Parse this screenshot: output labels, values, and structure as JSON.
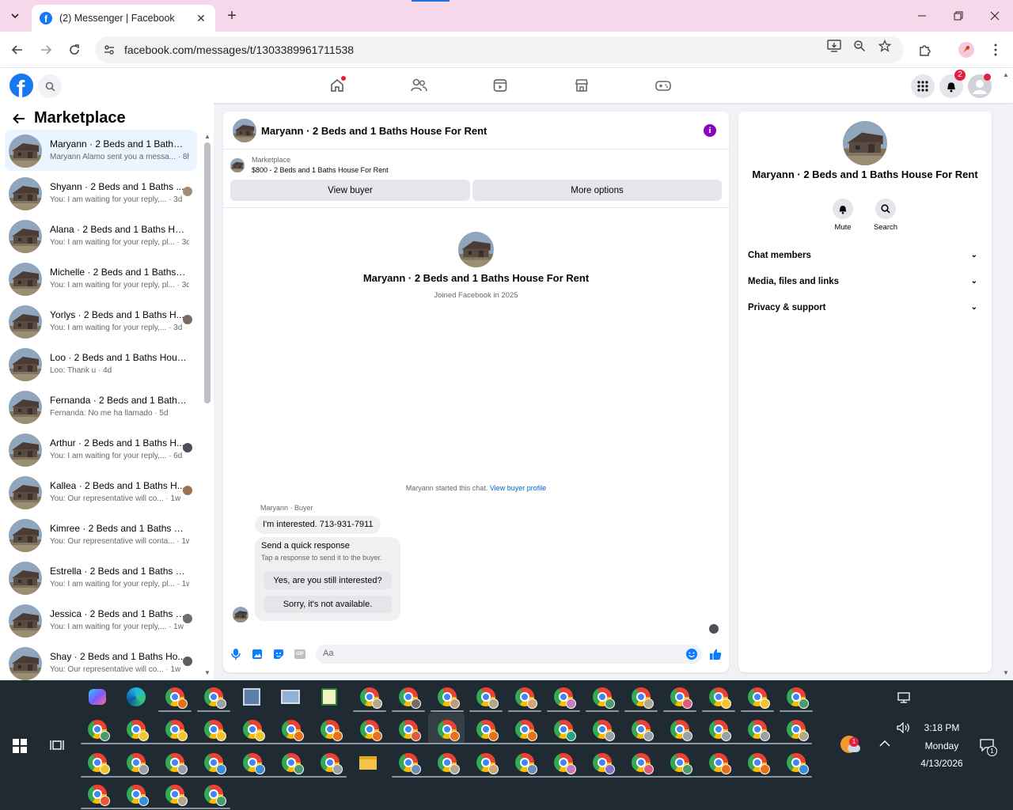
{
  "browser": {
    "tab_title": "(2) Messenger | Facebook",
    "url": "facebook.com/messages/t/1303389961711538"
  },
  "facebook": {
    "notification_count": "2"
  },
  "left_panel": {
    "title": "Marketplace",
    "conversations": [
      {
        "name": "Maryann · 2 Beds and 1 Baths H...",
        "snippet": "Maryann Alamo sent you a messa... · 8h",
        "active": true
      },
      {
        "name": "Shyann · 2 Beds and 1 Baths ...",
        "snippet": "You: I am waiting for your reply,... · 3d"
      },
      {
        "name": "Alana · 2 Beds and 1 Baths Hou...",
        "snippet": "You: I am waiting for your reply, pl... · 3d"
      },
      {
        "name": "Michelle · 2 Beds and 1 Baths H...",
        "snippet": "You: I am waiting for your reply, pl... · 3d"
      },
      {
        "name": "Yorlys · 2 Beds and 1 Baths H...",
        "snippet": "You: I am waiting for your reply,... · 3d"
      },
      {
        "name": "Loo · 2 Beds and 1 Baths House ...",
        "snippet": "Loo: Thank u · 4d"
      },
      {
        "name": "Fernanda · 2 Beds and 1 Baths ...",
        "snippet": "Fernanda: No me ha llamado · 5d"
      },
      {
        "name": "Arthur · 2 Beds and 1 Baths H...",
        "snippet": "You: I am waiting for your reply,... · 6d"
      },
      {
        "name": "Kallea · 2 Beds and 1 Baths H...",
        "snippet": "You: Our representative will co... · 1w"
      },
      {
        "name": "Kimree · 2 Beds and 1 Baths Ho...",
        "snippet": "You: Our representative will conta... · 1w"
      },
      {
        "name": "Estrella · 2 Beds and 1 Baths Ho...",
        "snippet": "You: I am waiting for your reply, pl... · 1w"
      },
      {
        "name": "Jessica · 2 Beds and 1 Baths H...",
        "snippet": "You: I am waiting for your reply,... · 1w"
      },
      {
        "name": "Shay · 2 Beds and 1 Baths Ho...",
        "snippet": "You: Our representative will co... · 1w"
      }
    ]
  },
  "chat": {
    "title": "Maryann · 2 Beds and 1 Baths House For Rent",
    "listing_category": "Marketplace",
    "listing_price_title": "$800 - 2 Beds and 1 Baths House For Rent",
    "view_buyer": "View buyer",
    "more_options": "More options",
    "profile_name": "Maryann · 2 Beds and 1 Baths House For Rent",
    "joined": "Joined Facebook in 2025",
    "started_text": "Maryann started this chat.",
    "view_buyer_profile": "View buyer profile",
    "sender_label": "Maryann · Buyer",
    "message": "I'm interested. 713-931-7911",
    "quick_title": "Send a quick response",
    "quick_sub": "Tap a response to send it to the buyer.",
    "quick_yes": "Yes, are you still interested?",
    "quick_no": "Sorry, it's not available.",
    "composer_placeholder": "Aa"
  },
  "right_panel": {
    "name": "Maryann · 2 Beds and 1 Baths House For Rent",
    "mute": "Mute",
    "search": "Search",
    "sections": [
      "Chat members",
      "Media, files and links",
      "Privacy & support"
    ]
  },
  "taskbar": {
    "time": "3:18 PM",
    "day": "Monday",
    "date": "4/13/2026",
    "weather_badge": "1",
    "action_center_count": "1"
  },
  "colors": {
    "fb_blue": "#1877f2",
    "tabbar_pink": "#f7d7ea",
    "info_purple": "#8a05be",
    "taskbar": "#1f2a32"
  }
}
